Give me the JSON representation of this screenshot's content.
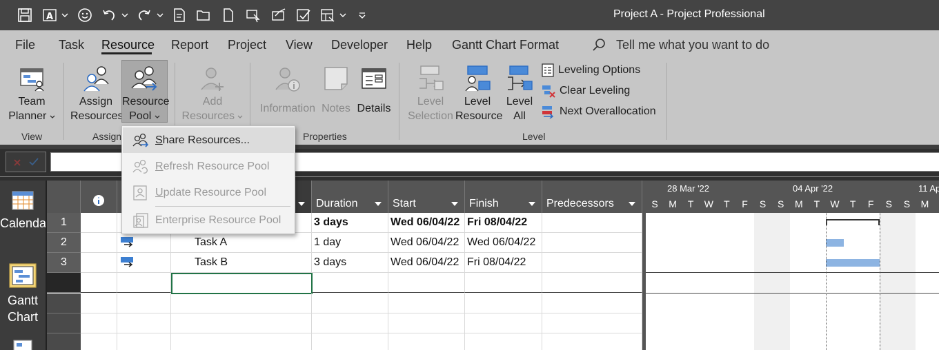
{
  "window": {
    "title": "Project A  -  Project Professional"
  },
  "quick_access": [
    "save-icon",
    "text-icon",
    "smiley-icon",
    "undo-icon",
    "redo-icon",
    "sheet-icon",
    "open-icon",
    "new-icon",
    "select-icon",
    "send-icon",
    "mark-icon",
    "table-icon",
    "customize-icon"
  ],
  "menu": {
    "tabs": [
      {
        "label": "File"
      },
      {
        "label": "Task"
      },
      {
        "label": "Resource",
        "active": true
      },
      {
        "label": "Report"
      },
      {
        "label": "Project"
      },
      {
        "label": "View"
      },
      {
        "label": "Developer"
      },
      {
        "label": "Help"
      },
      {
        "label": "Gantt Chart Format"
      }
    ],
    "tell_me": "Tell me what you want to do"
  },
  "ribbon": {
    "view": {
      "label": "View",
      "team_planner": {
        "line1": "Team",
        "line2": "Planner"
      }
    },
    "assignments": {
      "label": "Assignments",
      "label_visible": "Assign",
      "assign_resources": {
        "line1": "Assign",
        "line2": "Resources"
      },
      "resource_pool": {
        "line1": "Resource",
        "line2": "Pool"
      }
    },
    "insert": {
      "add_resources": {
        "line1": "Add",
        "line2": "Resources"
      }
    },
    "properties": {
      "label": "Properties",
      "information": "Information",
      "notes": "Notes",
      "details": "Details"
    },
    "level": {
      "label": "Level",
      "level_selection": {
        "line1": "Level",
        "line2": "Selection"
      },
      "level_resource": {
        "line1": "Level",
        "line2": "Resource"
      },
      "level_all": {
        "line1": "Level",
        "line2": "All"
      },
      "leveling_options": "Leveling Options",
      "clear_leveling": "Clear Leveling",
      "next_overallocation": "Next Overallocation"
    }
  },
  "dropdown": {
    "items": [
      {
        "label": "Share Resources...",
        "accel": "S",
        "rest": "hare Resources...",
        "enabled": true
      },
      {
        "label": "Refresh Resource Pool",
        "accel": "R",
        "rest": "efresh Resource Pool",
        "enabled": false
      },
      {
        "label": "Update Resource Pool",
        "accel": "U",
        "rest": "pdate Resource Pool",
        "enabled": false
      },
      {
        "label": "Enterprise Resource Pool",
        "accel": "",
        "rest": "Enterprise Resource Pool",
        "enabled": false
      }
    ]
  },
  "viewbar": {
    "calendar": "Calendar",
    "gantt_line1": "Gantt",
    "gantt_line2": "Chart"
  },
  "grid": {
    "columns": [
      "Duration",
      "Start",
      "Finish",
      "Predecessors"
    ],
    "rows": [
      {
        "id": "1",
        "name": "",
        "duration": "3 days",
        "start": "Wed 06/04/22",
        "finish": "Fri 08/04/22",
        "predecessors": "",
        "summary": true
      },
      {
        "id": "2",
        "name": "Task A",
        "duration": "1 day",
        "start": "Wed 06/04/22",
        "finish": "Wed 06/04/22",
        "predecessors": "",
        "summary": false
      },
      {
        "id": "3",
        "name": "Task B",
        "duration": "3 days",
        "start": "Wed 06/04/22",
        "finish": "Fri 08/04/22",
        "predecessors": "",
        "summary": false
      }
    ]
  },
  "gantt": {
    "weeks": [
      "28 Mar '22",
      "04 Apr '22",
      "11 Ap"
    ],
    "days": [
      "S",
      "M",
      "T",
      "W",
      "T",
      "F",
      "S",
      "S",
      "M",
      "T",
      "W",
      "T",
      "F",
      "S",
      "S",
      "M"
    ],
    "bars": [
      {
        "task": "1",
        "start": "Wed 06/04/22",
        "finish": "Fri 08/04/22",
        "type": "summary"
      },
      {
        "task": "2",
        "start": "Wed 06/04/22",
        "finish": "Wed 06/04/22",
        "type": "task"
      },
      {
        "task": "3",
        "start": "Wed 06/04/22",
        "finish": "Fri 08/04/22",
        "type": "task"
      }
    ],
    "bar_color": "#8db4e2"
  }
}
